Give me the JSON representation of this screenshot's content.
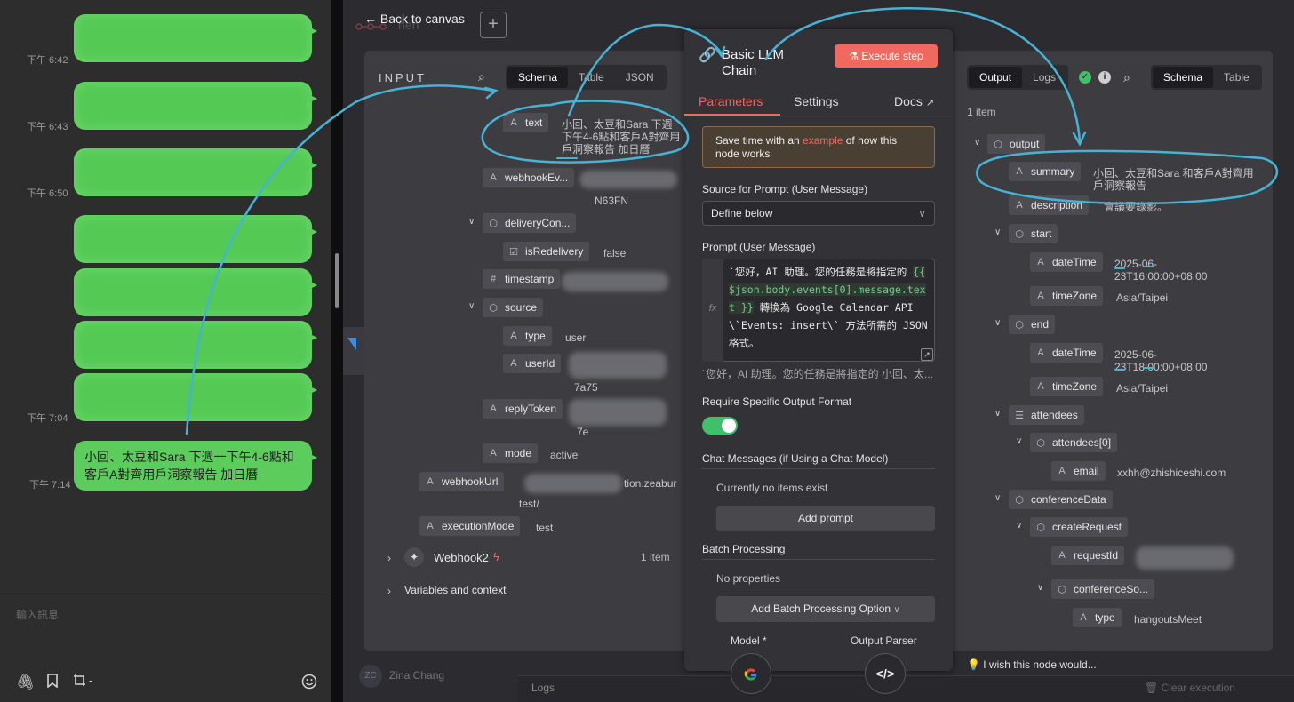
{
  "chat": {
    "times": [
      "下午 6:42",
      "下午 6:43",
      "下午 6:50",
      "下午 7:04",
      "下午 7:14"
    ],
    "last_message": "小回、太豆和Sara 下週一下午4-6點和客戶A對齊用戶洞察報告  加日曆",
    "input_placeholder": "輸入訊息",
    "bubble_color": "#5ccd5c"
  },
  "canvas": {
    "back_label": "Back to canvas",
    "workflow_name": "nen",
    "user_initials": "ZC",
    "user_name": "Zina Chang",
    "logs_label": "Logs",
    "clear_label": "Clear execution",
    "wish_label": "I wish this node would..."
  },
  "input": {
    "title": "INPUT",
    "views": [
      "Schema",
      "Table",
      "JSON"
    ],
    "fields": {
      "text_key": "text",
      "text_val": "小回、太豆和Sara 下週一下午4-6點和客戶A對齊用戶洞察報告 加日曆",
      "webhook_ev": "webhookEv...",
      "webhook_ev_val": "N63FN",
      "delivery": "deliveryCon...",
      "is_redelivery": "isRedelivery",
      "is_redelivery_val": "false",
      "timestamp": "timestamp",
      "source": "source",
      "type": "type",
      "type_val": "user",
      "user_id": "userId",
      "user_id_val": "7a75",
      "reply_token": "replyToken",
      "reply_token_val": "7e",
      "mode": "mode",
      "mode_val": "active",
      "webhook_url": "webhookUrl",
      "webhook_url_val": "tion.zeabur",
      "webhook_url_val2": "test/",
      "execution_mode": "executionMode",
      "execution_mode_val": "test",
      "webhook2": "Webhook2",
      "webhook2_count": "1 item",
      "variables": "Variables and context"
    }
  },
  "params": {
    "node_title": "Basic LLM Chain",
    "execute": "Execute step",
    "tabs": [
      "Parameters",
      "Settings",
      "Docs"
    ],
    "hint_pre": "Save time with an ",
    "hint_link": "example",
    "hint_post": " of how this node works",
    "source_label": "Source for Prompt (User Message)",
    "source_value": "Define below",
    "prompt_label": "Prompt (User Message)",
    "prompt_pre": "`您好，AI 助理。您的任務是將指定的",
    "prompt_expr": "{{ $json.body.events[0].message.text }}",
    "prompt_post": " 轉換為 Google Calendar API \\`Events: insert\\` 方法所需的 JSON 格式。",
    "prompt_preview": "`您好，AI 助理。您的任務是將指定的 小回、太...",
    "require_label": "Require Specific Output Format",
    "chat_msgs_label": "Chat Messages (if Using a Chat Model)",
    "no_items": "Currently no items exist",
    "add_prompt": "Add prompt",
    "batch_label": "Batch Processing",
    "no_props": "No properties",
    "add_batch": "Add Batch Processing Option",
    "model_label": "Model *",
    "parser_label": "Output Parser",
    "accent": "#f0695f",
    "toggle_color": "#3fc16a"
  },
  "output": {
    "tabs": [
      "Output",
      "Logs"
    ],
    "views": [
      "Schema",
      "Table"
    ],
    "items_count": "1 item",
    "fields": {
      "output": "output",
      "summary": "summary",
      "summary_val": "小回、太豆和Sara 和客戶A對齊用戶洞察報告",
      "description": "description",
      "description_val": "會議要錄影。",
      "start": "start",
      "start_dt": "dateTime",
      "start_dt_val": "2025-06-23T16:00:00+08:00",
      "start_tz": "timeZone",
      "start_tz_val": "Asia/Taipei",
      "end": "end",
      "end_dt": "dateTime",
      "end_dt_val": "2025-06-23T18:00:00+08:00",
      "end_tz": "timeZone",
      "end_tz_val": "Asia/Taipei",
      "attendees": "attendees",
      "attendees0": "attendees[0]",
      "email": "email",
      "email_val": "xxhh@zhishiceshi.com",
      "conference": "conferenceData",
      "create_request": "createRequest",
      "request_id": "requestId",
      "conf_solution": "conferenceSo...",
      "conf_type": "type",
      "conf_type_val": "hangoutsMeet"
    }
  }
}
